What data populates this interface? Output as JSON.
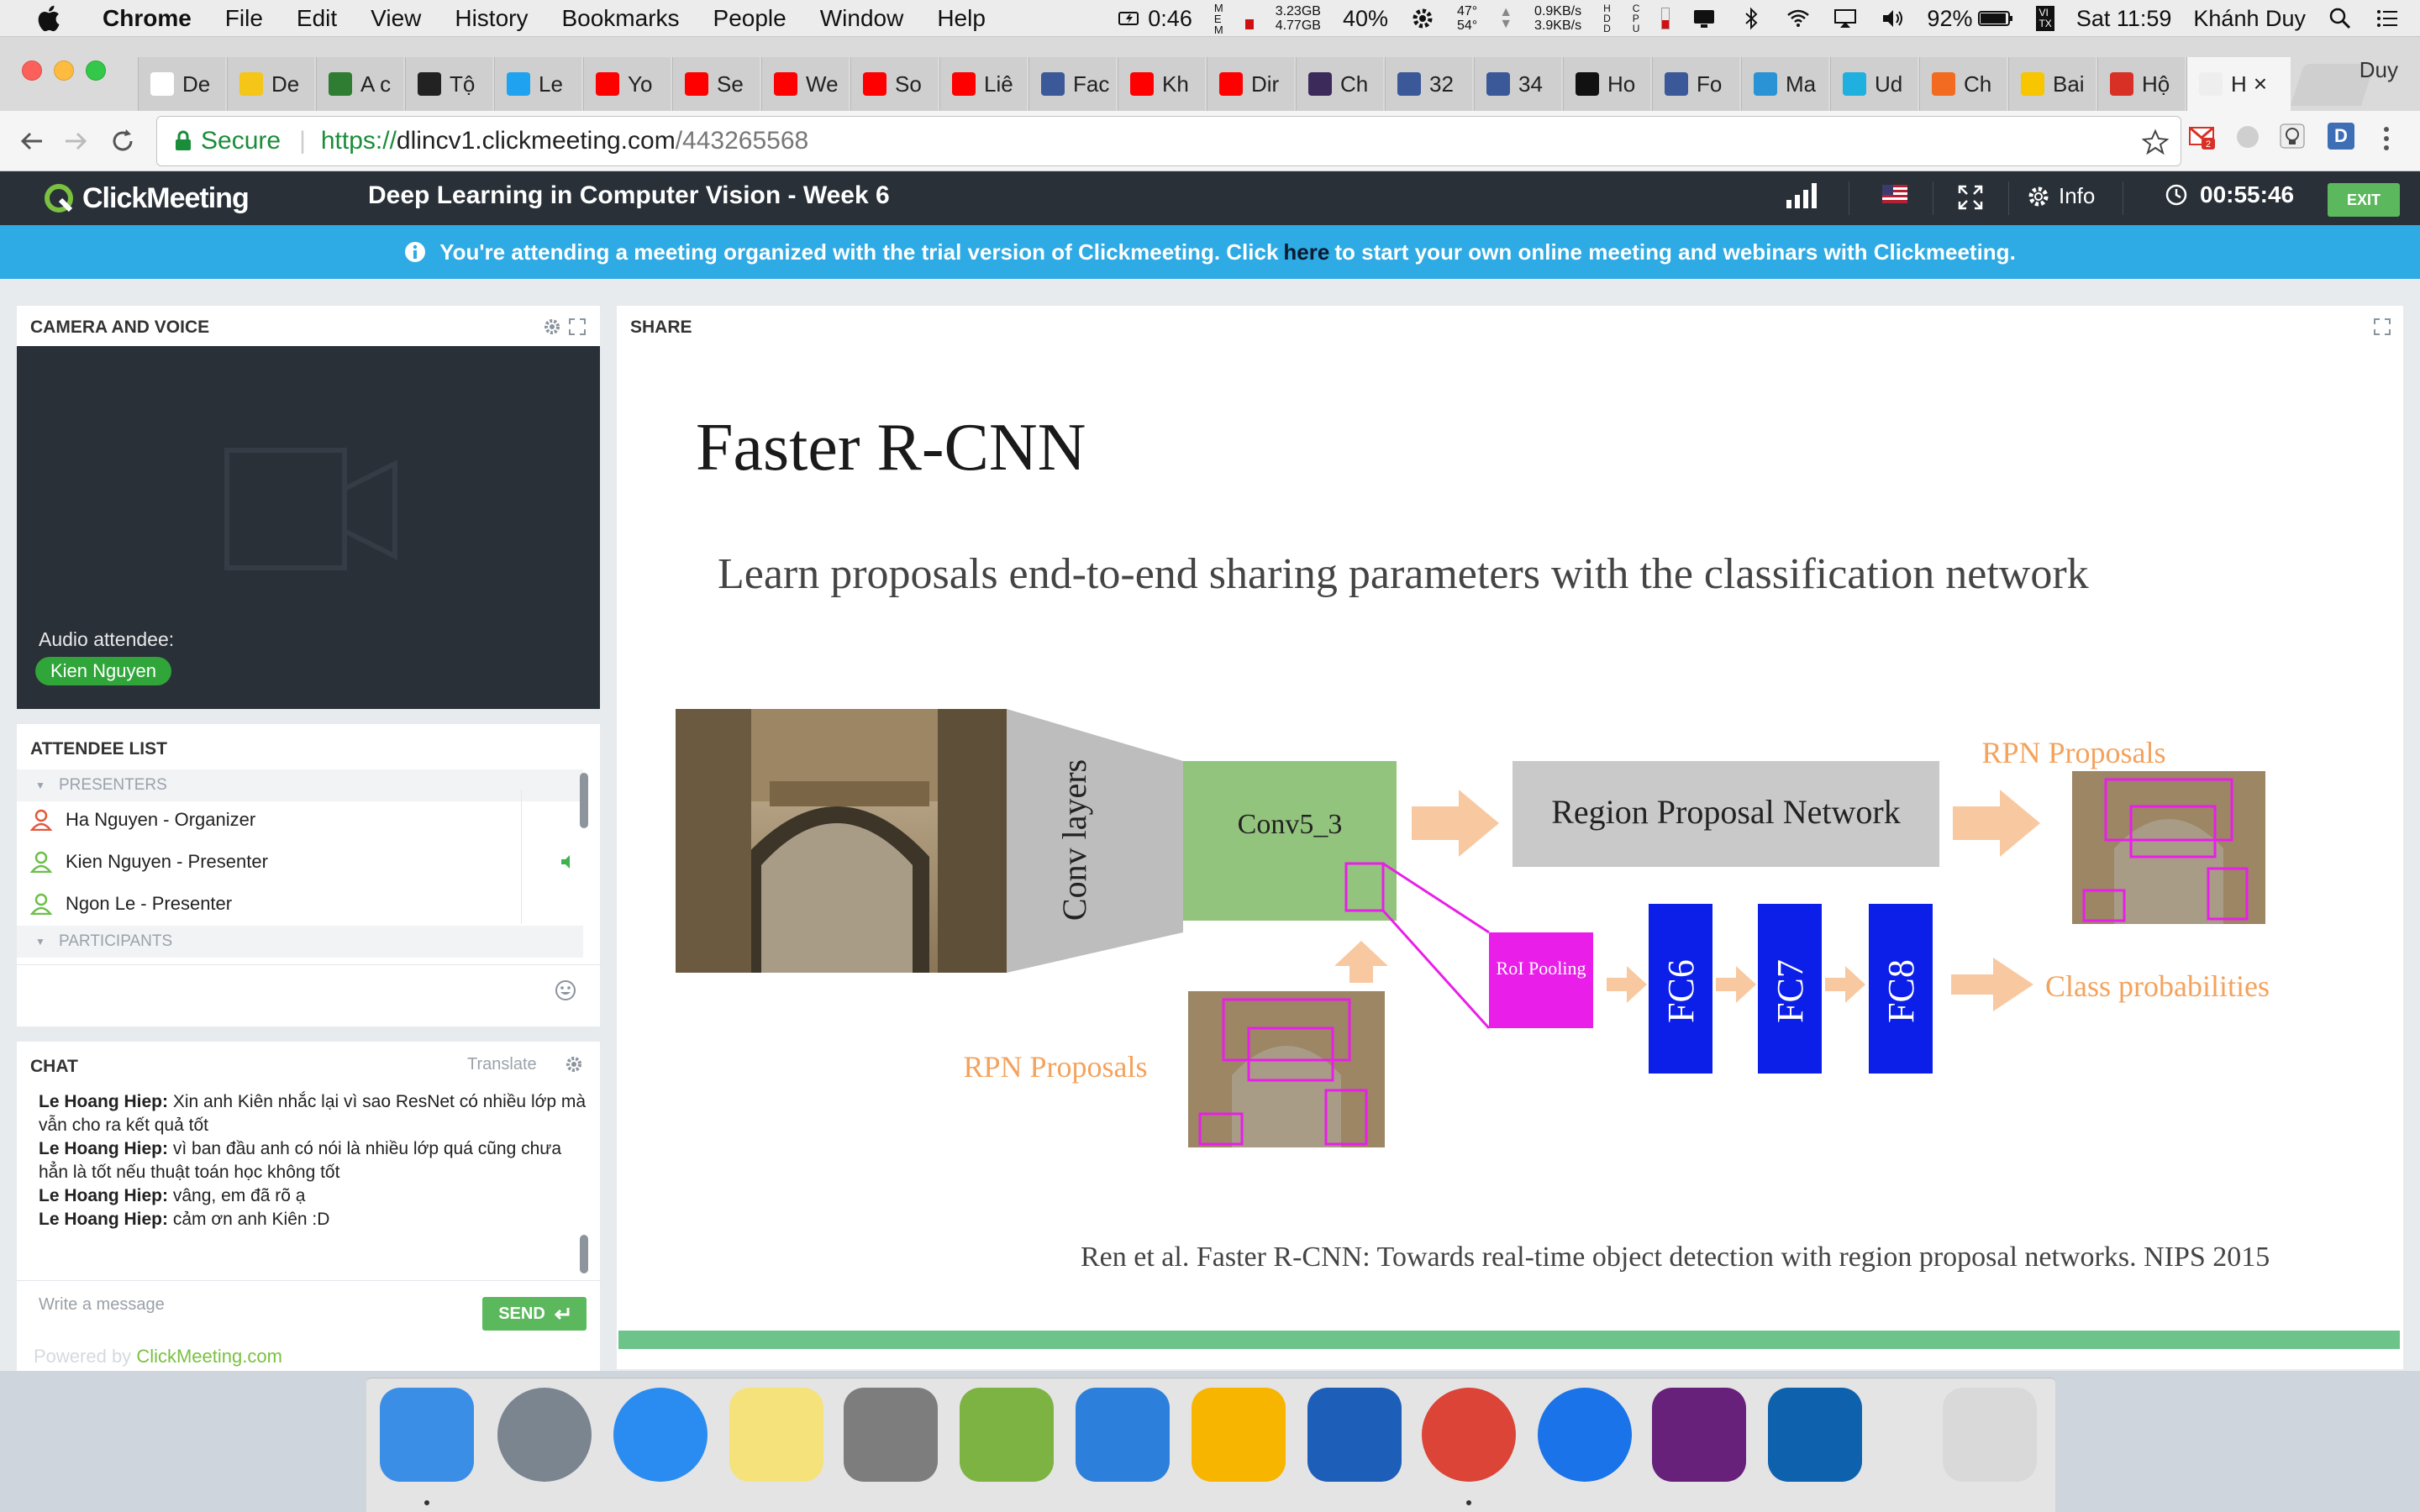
{
  "menubar": {
    "app": "Chrome",
    "items": [
      "File",
      "Edit",
      "View",
      "History",
      "Bookmarks",
      "People",
      "Window",
      "Help"
    ],
    "status": {
      "battery_time": "0:46",
      "mem_top": "3.23GB",
      "mem_bottom": "4.77GB",
      "cpu": "40%",
      "temp_top": "47°",
      "temp_bottom": "54°",
      "net_up": "0.9KB/s",
      "net_down": "3.9KB/s",
      "battery": "92%",
      "clock": "Sat 11:59",
      "user": "Khánh Duy"
    }
  },
  "tabs": [
    {
      "label": "De",
      "color": "#ffffff"
    },
    {
      "label": "De",
      "color": "#f5c518"
    },
    {
      "label": "A c",
      "color": "#2e7d32"
    },
    {
      "label": "Tộ",
      "color": "#222222"
    },
    {
      "label": "Le",
      "color": "#1fa3f0"
    },
    {
      "label": "Yo",
      "color": "#ff0000"
    },
    {
      "label": "Se",
      "color": "#ff0000"
    },
    {
      "label": "We",
      "color": "#ff0000"
    },
    {
      "label": "So",
      "color": "#ff0000"
    },
    {
      "label": "Liê",
      "color": "#ff0000"
    },
    {
      "label": "Fac",
      "color": "#3b5998"
    },
    {
      "label": "Kh",
      "color": "#ff0000"
    },
    {
      "label": "Dir",
      "color": "#ff0000"
    },
    {
      "label": "Ch",
      "color": "#3c2a5a"
    },
    {
      "label": "32",
      "color": "#3b5998"
    },
    {
      "label": "34",
      "color": "#3b5998"
    },
    {
      "label": "Ho",
      "color": "#111111"
    },
    {
      "label": "Fo",
      "color": "#3b5998"
    },
    {
      "label": "Ma",
      "color": "#2a93d5"
    },
    {
      "label": "Ud",
      "color": "#1fb0e0"
    },
    {
      "label": "Ch",
      "color": "#f26b21"
    },
    {
      "label": "Bai",
      "color": "#f7c600"
    },
    {
      "label": "Hộ",
      "color": "#d93025"
    },
    {
      "label": "H",
      "color": "#eeeeee"
    }
  ],
  "profile_name": "Duy",
  "omnibox": {
    "secure_label": "Secure",
    "protocol": "https://",
    "host": "dlincv1.clickmeeting.com",
    "path": "/443265568"
  },
  "cm": {
    "logo": "ClickMeeting",
    "meeting_title": "Deep Learning in Computer Vision - Week 6",
    "info_label": "Info",
    "timer": "00:55:46",
    "exit_label": "EXIT",
    "trial_text_before": "You're attending a meeting organized with the trial version of Clickmeeting. Click",
    "trial_link": "here",
    "trial_text_after": "to start your own online meeting and webinars with Clickmeeting."
  },
  "camera": {
    "title": "CAMERA AND VOICE",
    "audio_label": "Audio attendee:",
    "audio_name": "Kien Nguyen"
  },
  "attendees": {
    "title": "ATTENDEE LIST",
    "presenters_label": "PRESENTERS",
    "participants_label": "PARTICIPANTS",
    "rows": [
      {
        "name": "Ha Nguyen  - Organizer",
        "color": "#e2583e"
      },
      {
        "name": "Kien Nguyen  - Presenter",
        "color": "#6cbf49"
      },
      {
        "name": "Ngon Le  - Presenter",
        "color": "#6cbf49"
      }
    ]
  },
  "chat": {
    "title": "CHAT",
    "translate": "Translate",
    "messages": [
      {
        "author": "Le Hoang Hiep:",
        "text": "Xin anh Kiên nhắc lại vì sao ResNet có nhiều lớp mà vẫn cho ra kết quả tốt"
      },
      {
        "author": "Le Hoang Hiep:",
        "text": "vì ban đầu anh có nói là nhiều lớp quá cũng chưa hẳn là tốt nếu thuật toán học không tốt"
      },
      {
        "author": "Le Hoang Hiep:",
        "text": "vâng, em đã rõ ạ"
      },
      {
        "author": "Le Hoang Hiep:",
        "text": "cảm ơn anh Kiên :D"
      }
    ],
    "placeholder": "Write a message",
    "send_label": "SEND"
  },
  "share": {
    "title": "SHARE",
    "slide": {
      "title": "Faster R-CNN",
      "subtitle": "Learn proposals end-to-end sharing parameters with the classification network",
      "conv_layers": "Conv layers",
      "conv53": "Conv5_3",
      "rpn": "Region Proposal Network",
      "rpn_proposals_top": "RPN Proposals",
      "rpn_proposals_left": "RPN Proposals",
      "roi_pooling": "RoI Pooling",
      "fc6": "FC6",
      "fc7": "FC7",
      "fc8": "FC8",
      "class_prob": "Class probabilities",
      "citation": "Ren et al. Faster R-CNN: Towards real-time object detection with region proposal networks. NIPS 2015"
    }
  },
  "powered": {
    "prefix": "Powered by",
    "link": "ClickMeeting.com"
  },
  "dock": [
    {
      "name": "finder",
      "color": "#3a8ee6"
    },
    {
      "name": "launchpad",
      "color": "#7a8590"
    },
    {
      "name": "itunes",
      "color": "#2a8cf0"
    },
    {
      "name": "notes",
      "color": "#f6e27a"
    },
    {
      "name": "system-preferences",
      "color": "#7d7d7d"
    },
    {
      "name": "android-studio",
      "color": "#7cb342"
    },
    {
      "name": "xcode",
      "color": "#2d7fdc"
    },
    {
      "name": "sketch",
      "color": "#f7b500"
    },
    {
      "name": "teamviewer-vm",
      "color": "#1d5fb8"
    },
    {
      "name": "chrome",
      "color": "#db4437"
    },
    {
      "name": "1password",
      "color": "#1a73e8"
    },
    {
      "name": "visual-studio",
      "color": "#68217a"
    },
    {
      "name": "vscode",
      "color": "#0e62ad"
    },
    {
      "name": "trash",
      "color": "#d9d9d9"
    }
  ]
}
